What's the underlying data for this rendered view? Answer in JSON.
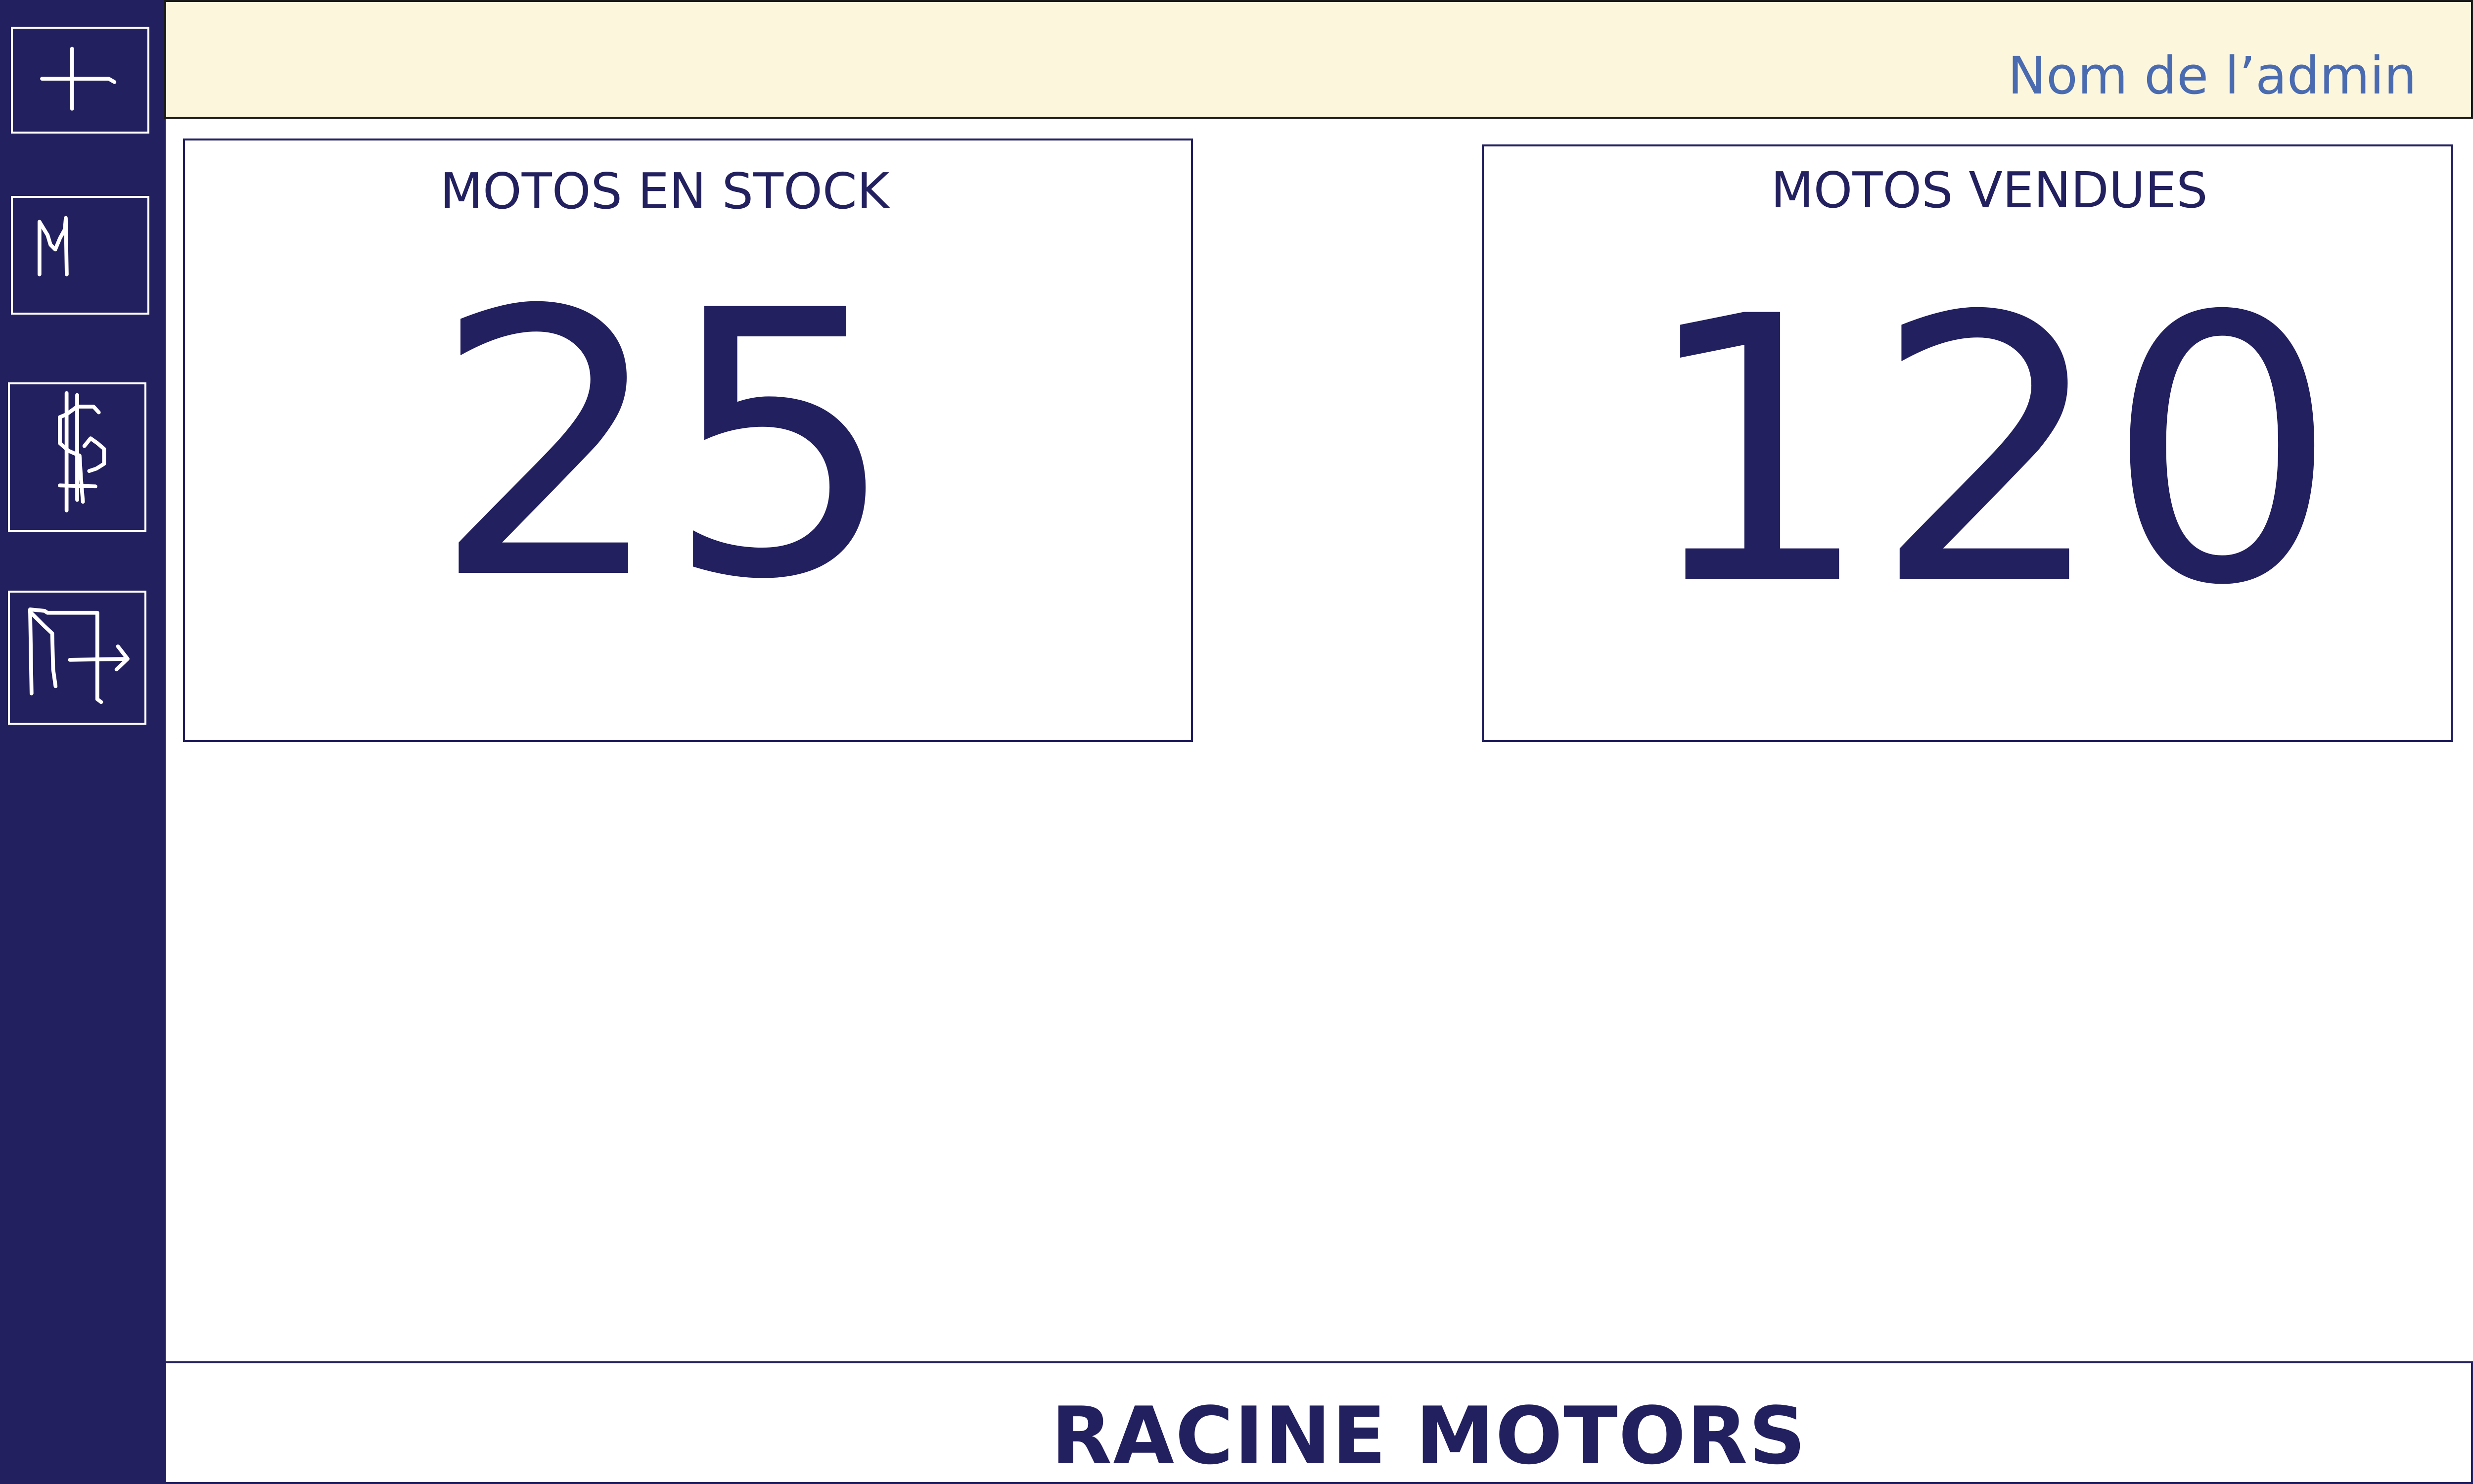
{
  "theme": {
    "sidebar_bg": "#23205f",
    "header_bg": "#fcf6dd",
    "accent": "#23205f",
    "admin_text": "#4a6bb0"
  },
  "sidebar": {
    "items": [
      {
        "icon": "plus-icon"
      },
      {
        "icon": "motorcycle-icon"
      },
      {
        "icon": "dollar-icon"
      },
      {
        "icon": "logout-icon"
      }
    ]
  },
  "header": {
    "admin_name": "Nom de l’admin"
  },
  "stats": {
    "stock": {
      "label": "MOTOS EN STOCK",
      "value": "25"
    },
    "sold": {
      "label": "MOTOS VENDUES",
      "value": "120"
    }
  },
  "footer": {
    "brand": "RACINE MOTORS"
  }
}
